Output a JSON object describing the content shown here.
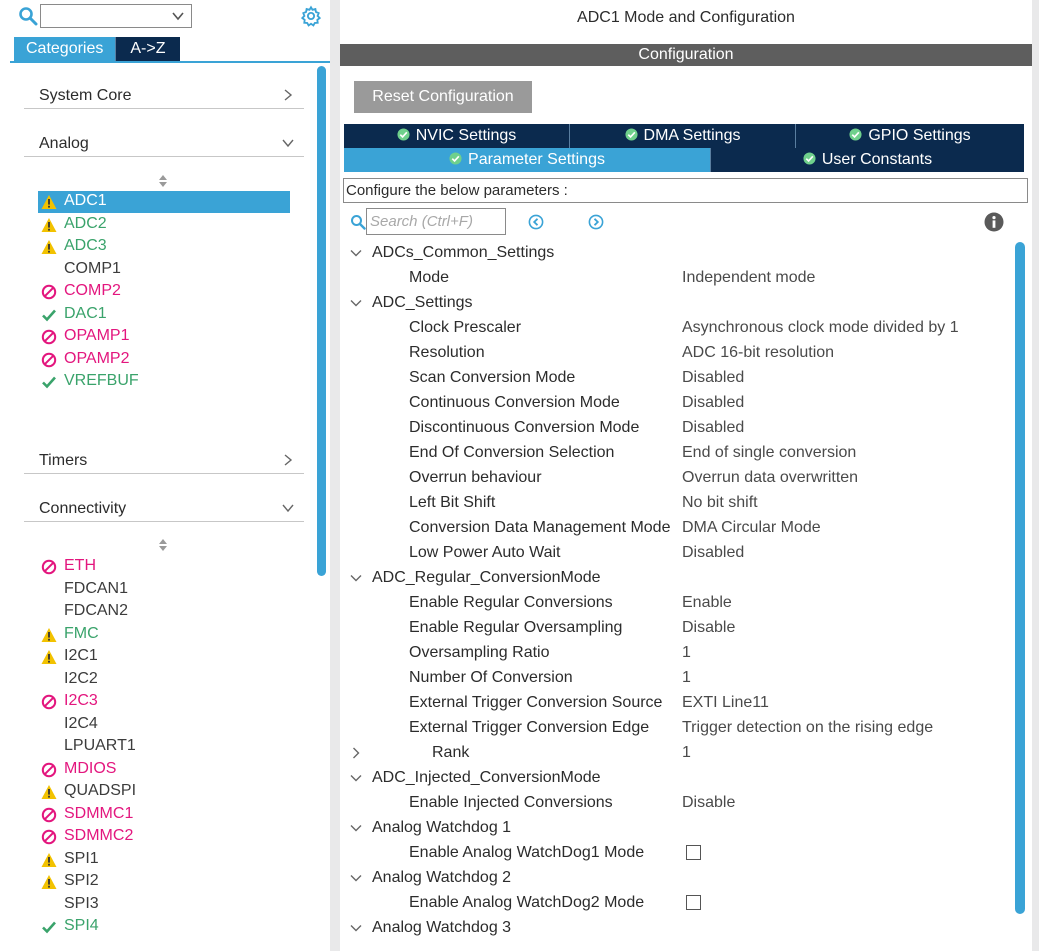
{
  "left": {
    "tabs": {
      "categories": "Categories",
      "az": "A->Z"
    },
    "categories": [
      {
        "label": "System Core",
        "state": "collapsed"
      },
      {
        "label": "Analog",
        "state": "expanded"
      },
      {
        "label": "Timers",
        "state": "collapsed"
      },
      {
        "label": "Connectivity",
        "state": "expanded"
      }
    ],
    "analog": [
      {
        "name": "ADC1",
        "status": "warning",
        "selected": true
      },
      {
        "name": "ADC2",
        "status": "warning"
      },
      {
        "name": "ADC3",
        "status": "warning"
      },
      {
        "name": "COMP1",
        "status": "none"
      },
      {
        "name": "COMP2",
        "status": "disabled"
      },
      {
        "name": "DAC1",
        "status": "ok"
      },
      {
        "name": "OPAMP1",
        "status": "disabled"
      },
      {
        "name": "OPAMP2",
        "status": "disabled"
      },
      {
        "name": "VREFBUF",
        "status": "ok"
      }
    ],
    "connectivity": [
      {
        "name": "ETH",
        "status": "disabled"
      },
      {
        "name": "FDCAN1",
        "status": "none"
      },
      {
        "name": "FDCAN2",
        "status": "none"
      },
      {
        "name": "FMC",
        "status": "warning"
      },
      {
        "name": "I2C1",
        "status": "warning-dark"
      },
      {
        "name": "I2C2",
        "status": "none"
      },
      {
        "name": "I2C3",
        "status": "disabled"
      },
      {
        "name": "I2C4",
        "status": "none"
      },
      {
        "name": "LPUART1",
        "status": "none"
      },
      {
        "name": "MDIOS",
        "status": "disabled"
      },
      {
        "name": "QUADSPI",
        "status": "warning-dark"
      },
      {
        "name": "SDMMC1",
        "status": "disabled"
      },
      {
        "name": "SDMMC2",
        "status": "disabled"
      },
      {
        "name": "SPI1",
        "status": "warning-dark"
      },
      {
        "name": "SPI2",
        "status": "warning-dark"
      },
      {
        "name": "SPI3",
        "status": "none"
      },
      {
        "name": "SPI4",
        "status": "ok"
      }
    ]
  },
  "right": {
    "title": "ADC1 Mode and Configuration",
    "config_bar": "Configuration",
    "reset_button": "Reset Configuration",
    "tabs_row1": [
      "NVIC Settings",
      "DMA Settings",
      "GPIO Settings"
    ],
    "tabs_row2": [
      "Parameter Settings",
      "User Constants"
    ],
    "description": "Configure the below parameters :",
    "search_placeholder": "Search (Ctrl+F)",
    "tree": [
      {
        "type": "group",
        "label": "ADCs_Common_Settings",
        "expanded": true
      },
      {
        "type": "param",
        "label": "Mode",
        "value": "Independent mode"
      },
      {
        "type": "group",
        "label": "ADC_Settings",
        "expanded": true
      },
      {
        "type": "param",
        "label": "Clock Prescaler",
        "value": "Asynchronous clock mode divided by 1"
      },
      {
        "type": "param",
        "label": "Resolution",
        "value": "ADC 16-bit resolution"
      },
      {
        "type": "param",
        "label": "Scan Conversion Mode",
        "value": "Disabled"
      },
      {
        "type": "param",
        "label": "Continuous Conversion Mode",
        "value": "Disabled"
      },
      {
        "type": "param",
        "label": "Discontinuous Conversion Mode",
        "value": "Disabled"
      },
      {
        "type": "param",
        "label": "End Of Conversion Selection",
        "value": "End of single conversion"
      },
      {
        "type": "param",
        "label": "Overrun behaviour",
        "value": "Overrun data overwritten"
      },
      {
        "type": "param",
        "label": "Left Bit Shift",
        "value": "No bit shift"
      },
      {
        "type": "param",
        "label": "Conversion Data Management Mode",
        "value": "DMA Circular Mode"
      },
      {
        "type": "param",
        "label": "Low Power Auto Wait",
        "value": "Disabled"
      },
      {
        "type": "group",
        "label": "ADC_Regular_ConversionMode",
        "expanded": true
      },
      {
        "type": "param",
        "label": "Enable Regular Conversions",
        "value": "Enable"
      },
      {
        "type": "param",
        "label": "Enable Regular Oversampling",
        "value": "Disable"
      },
      {
        "type": "param",
        "label": "Oversampling Ratio",
        "value": "1"
      },
      {
        "type": "param",
        "label": "Number Of Conversion",
        "value": "1"
      },
      {
        "type": "param",
        "label": "External Trigger Conversion Source",
        "value": "EXTI Line11"
      },
      {
        "type": "param",
        "label": "External Trigger Conversion Edge",
        "value": "Trigger detection on the rising edge"
      },
      {
        "type": "subgroup",
        "label": "Rank",
        "value": "1",
        "expanded": false
      },
      {
        "type": "group",
        "label": "ADC_Injected_ConversionMode",
        "expanded": true
      },
      {
        "type": "param",
        "label": "Enable Injected Conversions",
        "value": "Disable"
      },
      {
        "type": "group",
        "label": "Analog Watchdog 1",
        "expanded": true
      },
      {
        "type": "check",
        "label": "Enable Analog WatchDog1 Mode",
        "checked": false
      },
      {
        "type": "group",
        "label": "Analog Watchdog 2",
        "expanded": true
      },
      {
        "type": "check",
        "label": "Enable Analog WatchDog2 Mode",
        "checked": false
      },
      {
        "type": "group",
        "label": "Analog Watchdog 3",
        "expanded": true
      }
    ]
  },
  "colors": {
    "accent": "#3aa3d6",
    "navy": "#0b2a4e",
    "warning": "#f2c200",
    "disabled": "#e3167e",
    "ok_green": "#3aa36b"
  }
}
